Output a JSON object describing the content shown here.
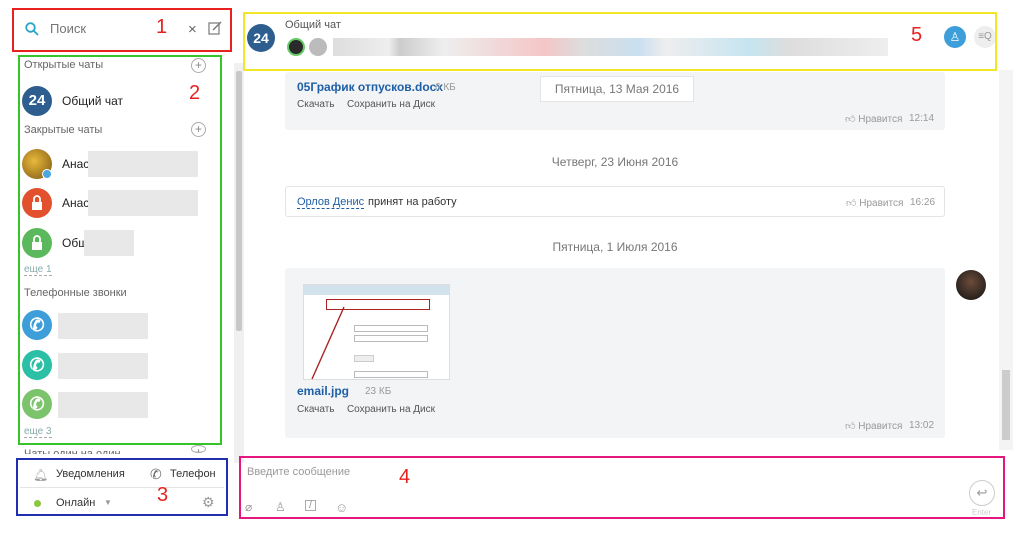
{
  "search": {
    "placeholder": "Поиск"
  },
  "sidebar": {
    "open_chats_title": "Открытые чаты",
    "general_chat": {
      "badge": "24",
      "name": "Общий чат"
    },
    "closed_chats_title": "Закрытые чаты",
    "closed_items": [
      {
        "name": "Анас"
      },
      {
        "name": "Анас"
      },
      {
        "name": "Общ"
      }
    ],
    "more_closed": "еще 1",
    "phone_calls_title": "Телефонные звонки",
    "more_calls": "еще 3",
    "one_on_one_title": "Чаты один на один"
  },
  "status": {
    "notifications": "Уведомления",
    "phone": "Телефон",
    "online": "Онлайн"
  },
  "header": {
    "badge": "24",
    "title": "Общий чат"
  },
  "messages": {
    "file1": {
      "name": "05График отпусков.docx",
      "size": "6 КБ",
      "download": "Скачать",
      "save": "Сохранить на Диск",
      "date_tag": "Пятница, 13 Мая 2016",
      "like": "Нравится",
      "time": "12:14"
    },
    "sep1": "Четверг, 23 Июня 2016",
    "notice": {
      "person": "Орлов Денис",
      "text": "принят на работу",
      "like": "Нравится",
      "time": "16:26"
    },
    "sep2": "Пятница, 1 Июля 2016",
    "file2": {
      "name": "email.jpg",
      "size": "23 КБ",
      "download": "Скачать",
      "save": "Сохранить на Диск",
      "like": "Нравится",
      "time": "13:02"
    }
  },
  "composer": {
    "placeholder": "Введите сообщение",
    "enter_label": "Enter"
  },
  "annotations": [
    "1",
    "2",
    "3",
    "4",
    "5"
  ],
  "colors": {
    "red": "#e8211e",
    "green": "#37c42b",
    "blue": "#1f2fb0",
    "magenta": "#e5177f",
    "yellow": "#f2e628"
  }
}
